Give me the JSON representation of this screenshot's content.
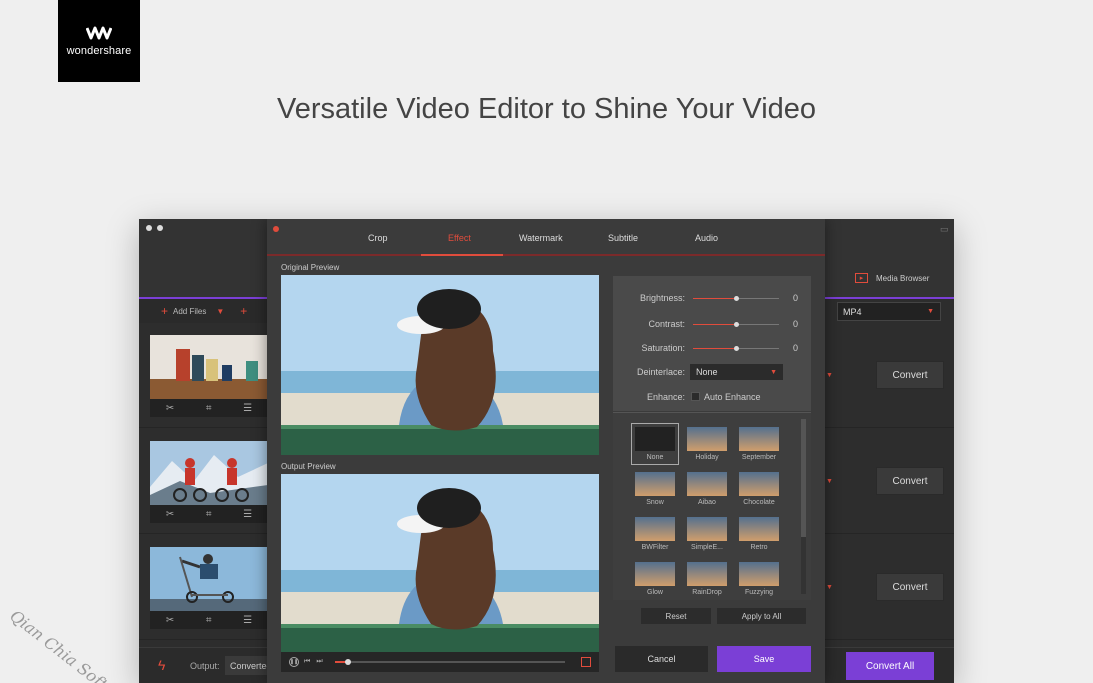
{
  "brand": {
    "name": "wondershare"
  },
  "headline": "Versatile Video Editor to Shine Your Video",
  "watermark": "Qian Chia Soft",
  "app": {
    "add_files": "Add Files",
    "media_browser": "Media Browser",
    "format": "MP4",
    "rows": [
      {
        "convert": "Convert"
      },
      {
        "convert": "Convert"
      },
      {
        "convert": "Convert"
      }
    ],
    "output_label": "Output:",
    "output_value": "Converted",
    "convert_all": "Convert All"
  },
  "editor": {
    "tabs": [
      {
        "label": "Crop",
        "active": false
      },
      {
        "label": "Effect",
        "active": true
      },
      {
        "label": "Watermark",
        "active": false
      },
      {
        "label": "Subtitle",
        "active": false
      },
      {
        "label": "Audio",
        "active": false
      }
    ],
    "original_preview": "Original Preview",
    "output_preview": "Output Preview",
    "playback_progress": 0.06,
    "settings": {
      "brightness": {
        "label": "Brightness:",
        "value": "0",
        "level": 0.5
      },
      "contrast": {
        "label": "Contrast:",
        "value": "0",
        "level": 0.5
      },
      "saturation": {
        "label": "Saturation:",
        "value": "0",
        "level": 0.5
      },
      "deinterlace": {
        "label": "Deinterlace:",
        "value": "None"
      },
      "enhance": {
        "label": "Enhance:",
        "option": "Auto Enhance",
        "checked": false
      }
    },
    "filters": [
      "None",
      "Holiday",
      "September",
      "Snow",
      "Aibao",
      "Chocolate",
      "BWFilter",
      "SimpleE...",
      "Retro",
      "Glow",
      "RainDrop",
      "Fuzzying"
    ],
    "selected_filter": "None",
    "reset": "Reset",
    "apply_to_all": "Apply to All",
    "cancel": "Cancel",
    "save": "Save"
  },
  "colors": {
    "accent": "#e14c3c",
    "purple": "#7b3fd6",
    "panel": "#3b3b3b"
  }
}
